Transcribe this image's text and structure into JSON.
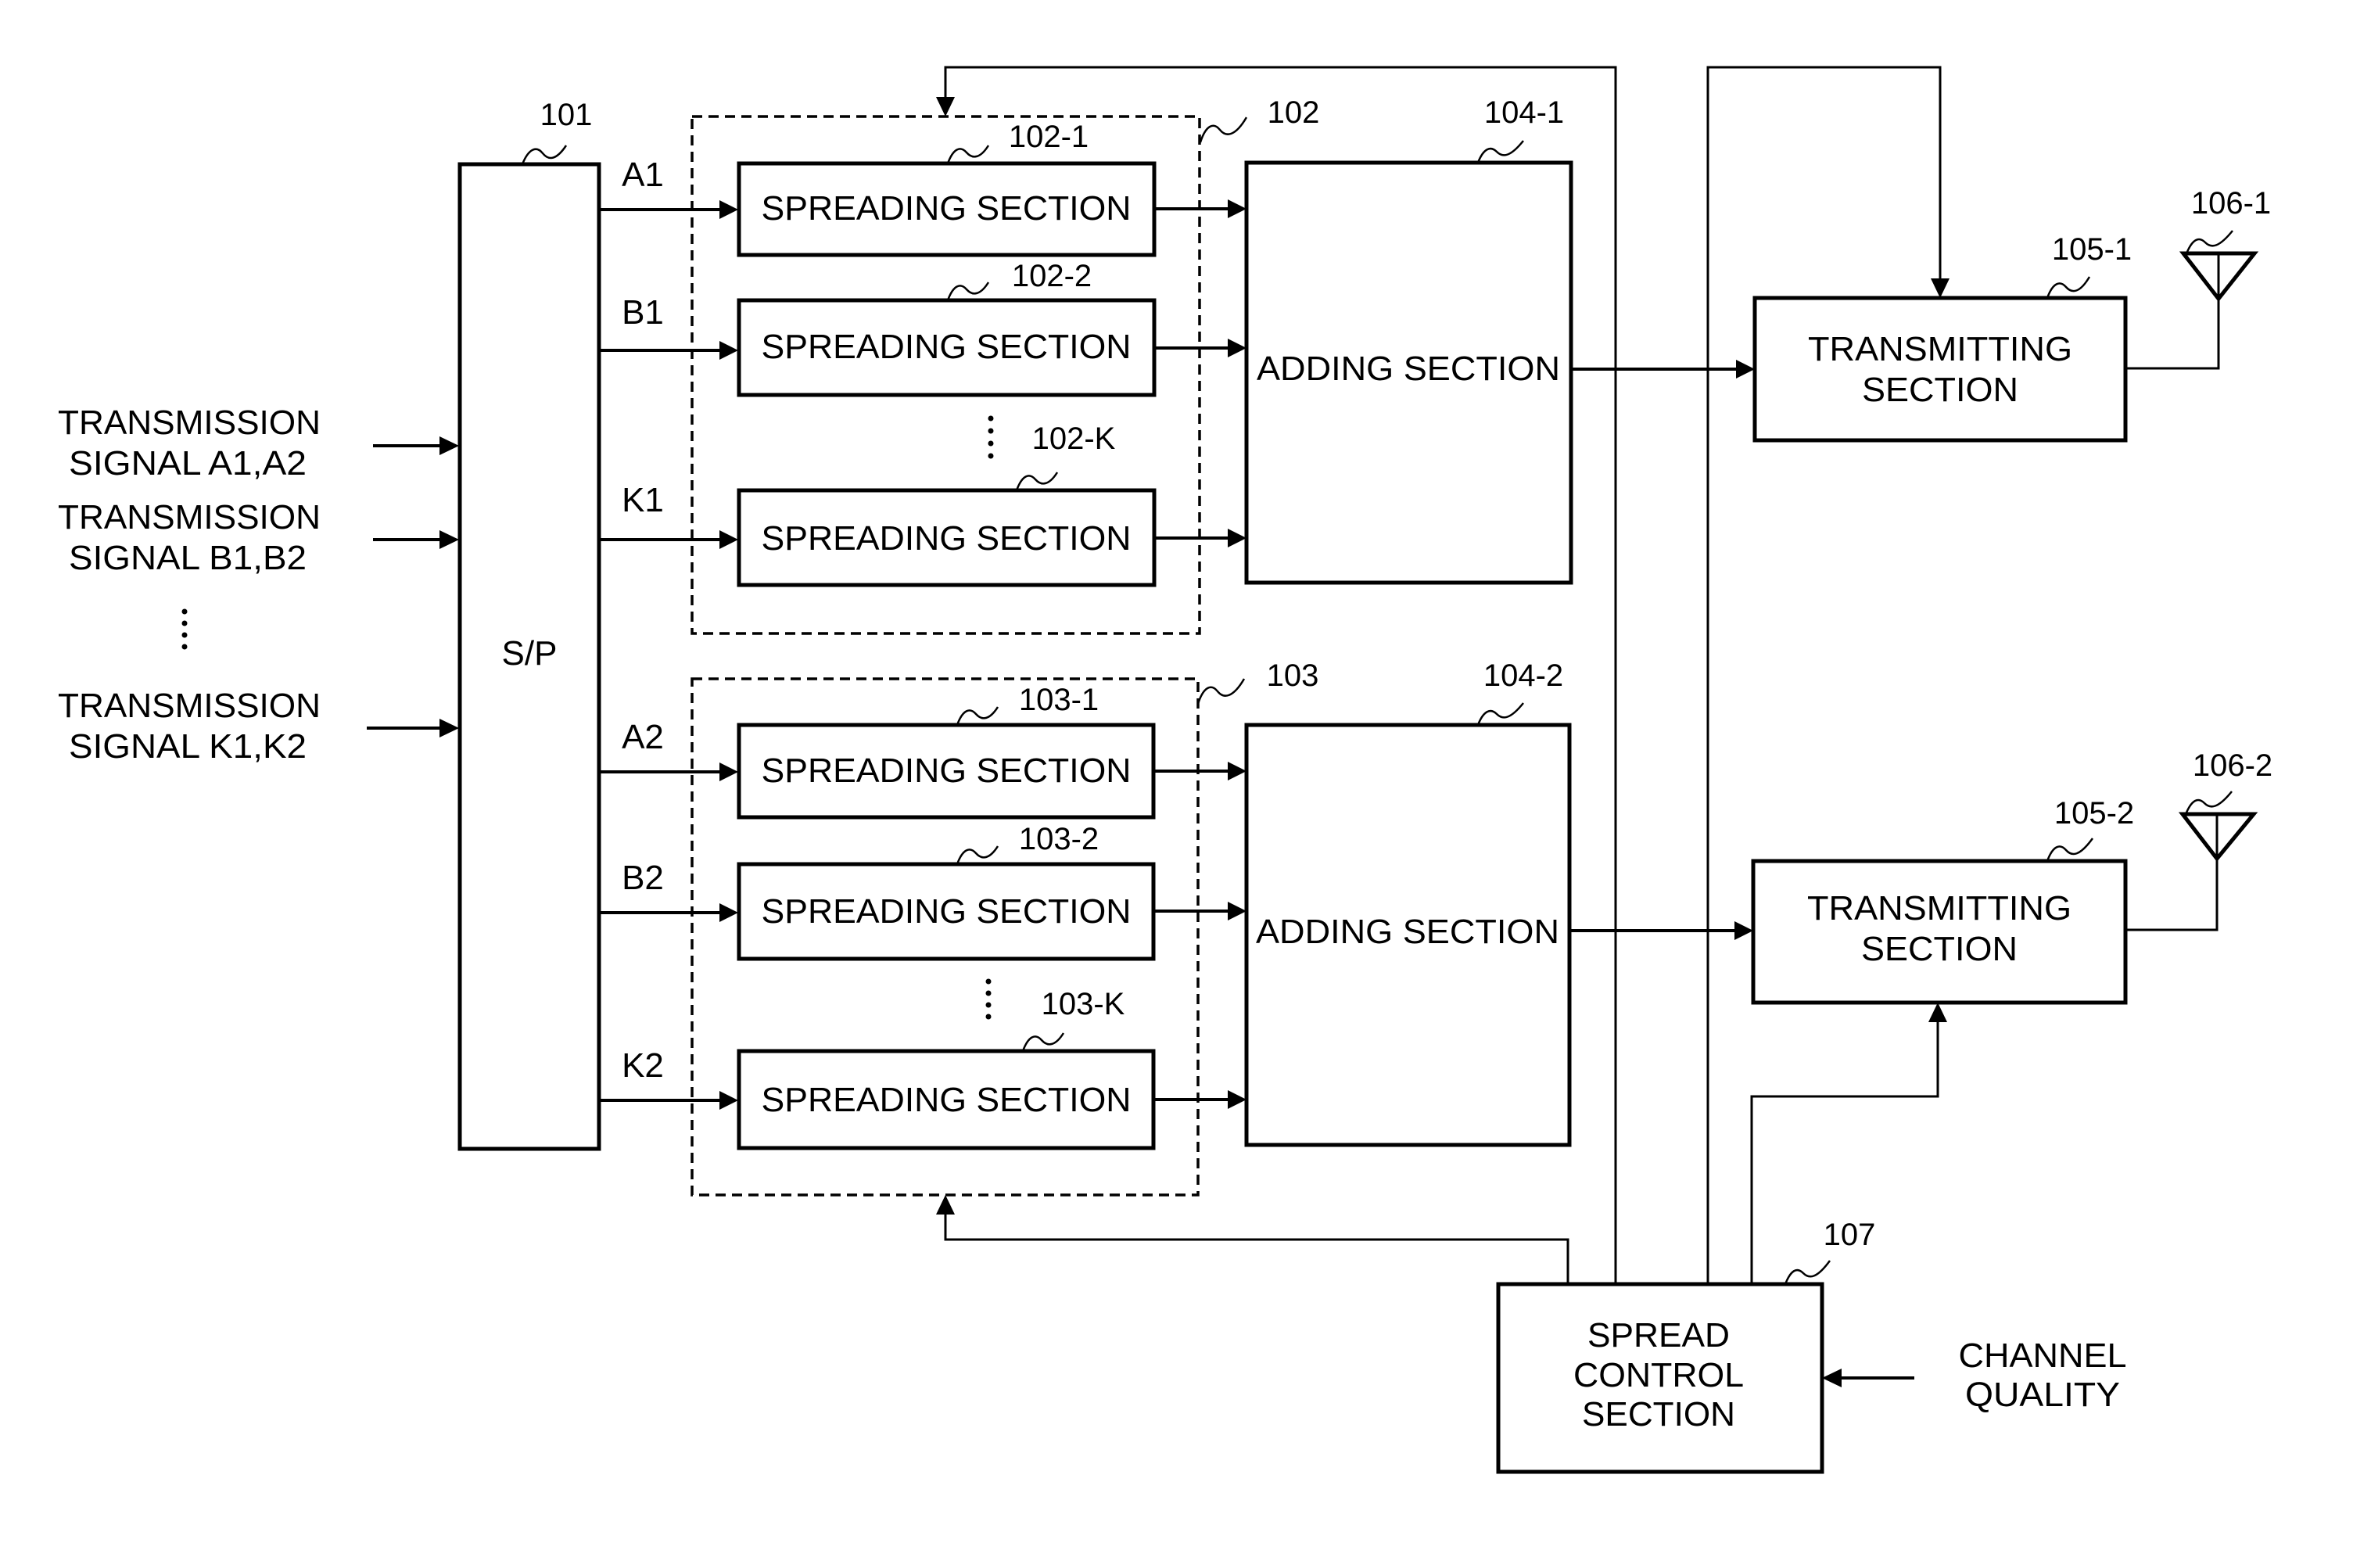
{
  "figure": {
    "inputs": [
      {
        "ref": "",
        "line1": "TRANSMISSION",
        "line2": "SIGNAL A1,A2"
      },
      {
        "ref": "",
        "line1": "TRANSMISSION",
        "line2": "SIGNAL B1,B2"
      },
      {
        "ref": "",
        "line1": "TRANSMISSION",
        "line2": "SIGNAL K1,K2"
      }
    ],
    "sp": {
      "ref": "101",
      "label": "S/P"
    },
    "outputs_group1": [
      "A1",
      "B1",
      "K1"
    ],
    "outputs_group2": [
      "A2",
      "B2",
      "K2"
    ],
    "group1": {
      "ref": "102",
      "spreaders": [
        {
          "ref": "102-1",
          "label": "SPREADING SECTION"
        },
        {
          "ref": "102-2",
          "label": "SPREADING SECTION"
        },
        {
          "ref": "102-K",
          "label": "SPREADING SECTION"
        }
      ]
    },
    "group2": {
      "ref": "103",
      "spreaders": [
        {
          "ref": "103-1",
          "label": "SPREADING SECTION"
        },
        {
          "ref": "103-2",
          "label": "SPREADING SECTION"
        },
        {
          "ref": "103-K",
          "label": "SPREADING SECTION"
        }
      ]
    },
    "adders": [
      {
        "ref": "104-1",
        "label": "ADDING SECTION"
      },
      {
        "ref": "104-2",
        "label": "ADDING SECTION"
      }
    ],
    "transmitters": [
      {
        "ref": "105-1",
        "line1": "TRANSMITTING",
        "line2": "SECTION"
      },
      {
        "ref": "105-2",
        "line1": "TRANSMITTING",
        "line2": "SECTION"
      }
    ],
    "antennas": [
      {
        "ref": "106-1"
      },
      {
        "ref": "106-2"
      }
    ],
    "spread_control": {
      "ref": "107",
      "line1": "SPREAD",
      "line2": "CONTROL",
      "line3": "SECTION"
    },
    "channel_quality": {
      "line1": "CHANNEL",
      "line2": "QUALITY"
    },
    "ellipsis": "⋮"
  },
  "colors": {
    "ink": "#000000",
    "paper": "#ffffff"
  }
}
